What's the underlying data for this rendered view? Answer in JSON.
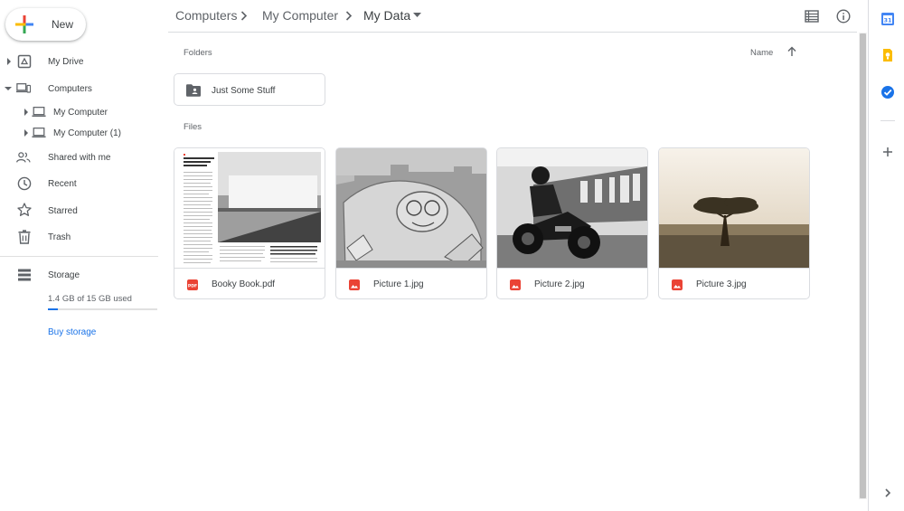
{
  "new_button": {
    "label": "New"
  },
  "sidebar": {
    "my_drive": "My Drive",
    "computers": "Computers",
    "computer_1": "My Computer",
    "computer_2": "My Computer (1)",
    "shared": "Shared with me",
    "recent": "Recent",
    "starred": "Starred",
    "trash": "Trash",
    "storage": "Storage",
    "storage_used": "1.4 GB of 15 GB used",
    "storage_fraction": 0.09,
    "buy_storage": "Buy storage"
  },
  "breadcrumb": [
    "Computers",
    "My Computer",
    "My Data"
  ],
  "main": {
    "folders_label": "Folders",
    "files_label": "Files",
    "sort_label": "Name",
    "folders": [
      {
        "name": "Just Some Stuff"
      }
    ],
    "files": [
      {
        "name": "Booky Book.pdf",
        "type": "pdf"
      },
      {
        "name": "Picture 1.jpg",
        "type": "image"
      },
      {
        "name": "Picture 2.jpg",
        "type": "image"
      },
      {
        "name": "Picture 3.jpg",
        "type": "image"
      }
    ]
  },
  "colors": {
    "accent": "#1a73e8",
    "file_icon": "#ea4335",
    "border": "#dadce0"
  }
}
